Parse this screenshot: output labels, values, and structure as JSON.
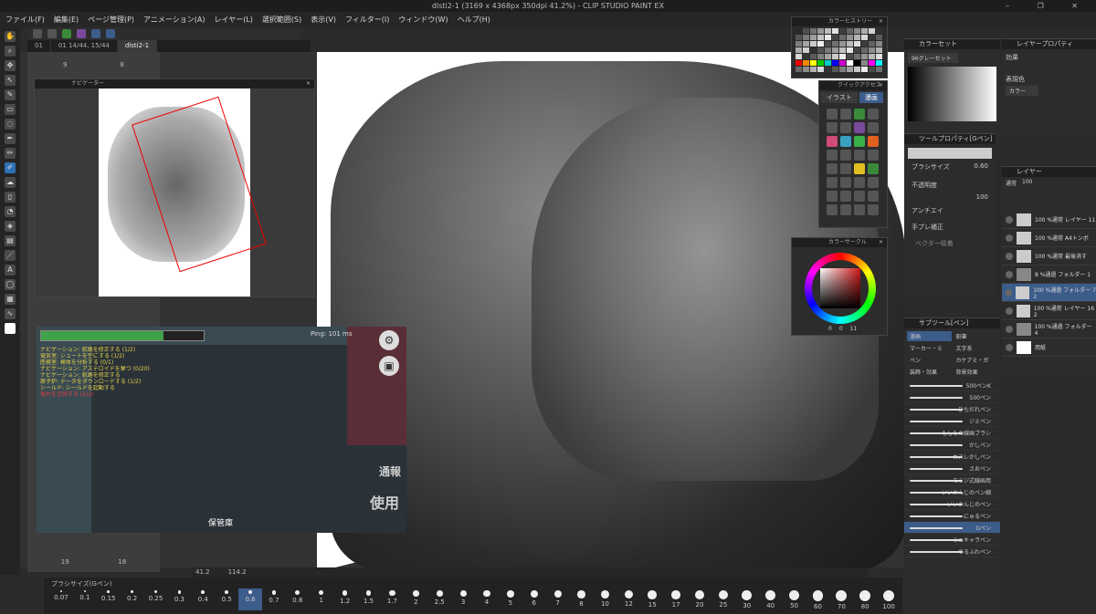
{
  "window": {
    "title": "dlsti2-1 (3169 x 4368px 350dpi 41.2%) - CLIP STUDIO PAINT EX",
    "controls": "– ❐ ✕"
  },
  "menu": [
    "ファイル(F)",
    "編集(E)",
    "ページ管理(P)",
    "アニメーション(A)",
    "レイヤー(L)",
    "選択範囲(S)",
    "表示(V)",
    "フィルター(I)",
    "ウィンドウ(W)",
    "ヘルプ(H)"
  ],
  "tabs": [
    "01",
    "01 14/44, 15/44",
    "dlsti2-1"
  ],
  "thumbnails": {
    "top": [
      "9",
      "8"
    ],
    "bottom": [
      "19",
      "18"
    ]
  },
  "navigator": {
    "title": "ナビゲーター"
  },
  "game": {
    "ping": "Ping: 101 ms",
    "tasks": [
      "ナビゲーション: 航路を修正する (1/2)",
      "電気室: シュートを空にする (1/2)",
      "医務室: 検体を分析する (0/1)",
      "ナビゲーション: アステロイドを撃つ (0/20)",
      "ナビゲーション: 航路を修正する",
      "原子炉: データをダウンロードする (1/2)",
      "シールド: シールドを起動する",
      "電力を迂回する (1/2)"
    ],
    "room_label": "保管庫",
    "report_label": "通報",
    "use_label": "使用"
  },
  "status": {
    "left": "41.2",
    "zoom": "114.2"
  },
  "brush_sizes": {
    "title": "ブラシサイズ(Gペン)",
    "selected": "0.6",
    "values": [
      "0.07",
      "0.1",
      "0.15",
      "0.2",
      "0.25",
      "0.3",
      "0.4",
      "0.5",
      "0.6",
      "0.7",
      "0.8",
      "1",
      "1.2",
      "1.5",
      "1.7",
      "2",
      "2.5",
      "3",
      "4",
      "5",
      "6",
      "7",
      "8",
      "10",
      "12",
      "15",
      "17",
      "20",
      "25",
      "30",
      "40",
      "50",
      "60",
      "70",
      "80",
      "100"
    ]
  },
  "color_history": {
    "title": "カラーヒストリー"
  },
  "quick_access": {
    "title": "クイックアクセス",
    "tabs": [
      "イラスト",
      "漫画"
    ]
  },
  "color_wheel": {
    "title": "カラーサークル",
    "h": "0",
    "s": "0",
    "v": "11"
  },
  "color_set": {
    "title": "カラーセット",
    "preset": "96グレーセット"
  },
  "layer_property": {
    "title": "レイヤープロパティ",
    "effect": "効果",
    "display_color": "表現色",
    "color_mode": "カラー"
  },
  "tool_property": {
    "title": "ツールプロパティ[Gペン]",
    "brush_size_label": "ブラシサイズ",
    "brush_size": "0.60",
    "opacity_label": "不透明度",
    "opacity": "100",
    "antialias_label": "アンチエイ",
    "stabilization_label": "手ブレ補正",
    "vector_label": "ベクター吸着"
  },
  "layers": {
    "title": "レイヤー",
    "blend": "通常",
    "opacity": "100",
    "rows": [
      {
        "name": "100 %通常 レイヤー 11"
      },
      {
        "name": "100 %通常 A4トンボ"
      },
      {
        "name": "100 %通常 最後消す"
      },
      {
        "name": "8 %通過 フォルダー 1"
      },
      {
        "name": "100 %通過 フォルダー 7 2"
      },
      {
        "name": "100 %通常 レイヤー 16 2"
      },
      {
        "name": "100 %通過 フォルダー 4"
      },
      {
        "name": "用紙"
      }
    ]
  },
  "subtool": {
    "title": "サブツール[ペン]",
    "groups": [
      "漫画",
      "鉛筆",
      "マーカー・ミ",
      "文字系",
      "ペン",
      "カケアミ・ガ",
      "装飾・効果",
      "背景効果"
    ],
    "brushes": [
      "500ペンK",
      "500ペン",
      "ひもだれペン",
      "ジミペン",
      "もしもの線画ブラシ",
      "かしペン",
      "カスレかしペン",
      "さおペン",
      "モミジ式線画用",
      "いいかんじのペン細",
      "いいかんじのペン",
      "にゅるペン",
      "Gペン",
      "ミニキャラペン",
      "ゆるふわペン"
    ],
    "selected": "Gペン"
  }
}
